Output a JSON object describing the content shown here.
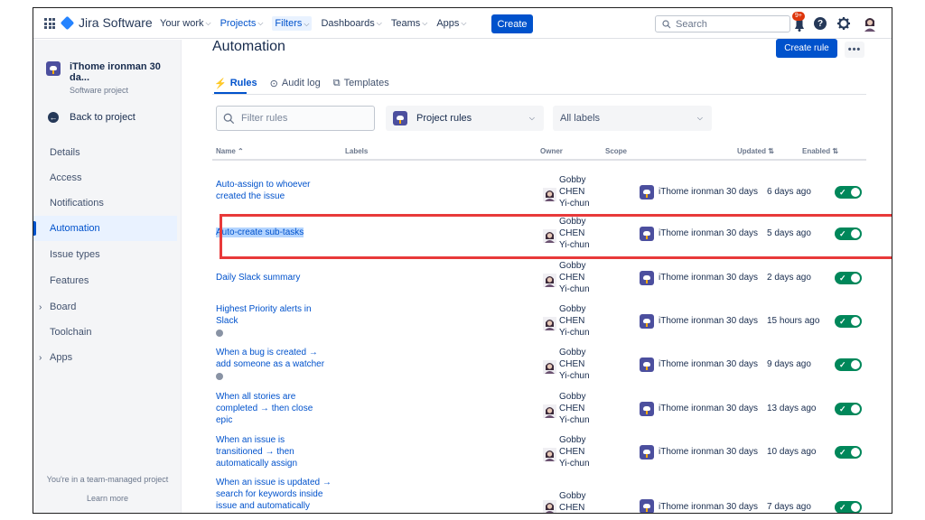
{
  "topnav": {
    "logo": "Jira Software",
    "items": [
      {
        "label": "Your work"
      },
      {
        "label": "Projects"
      },
      {
        "label": "Filters"
      },
      {
        "label": "Dashboards"
      },
      {
        "label": "Teams"
      },
      {
        "label": "Apps"
      }
    ],
    "create": "Create",
    "search_placeholder": "Search",
    "notifications_badge": "9+",
    "help": "?"
  },
  "sidebar": {
    "project_name": "iThome ironman 30 da...",
    "project_type": "Software project",
    "back": "Back to project",
    "items": [
      {
        "label": "Details"
      },
      {
        "label": "Access"
      },
      {
        "label": "Notifications"
      },
      {
        "label": "Automation"
      },
      {
        "label": "Issue types"
      },
      {
        "label": "Features"
      },
      {
        "label": "Board"
      },
      {
        "label": "Toolchain"
      },
      {
        "label": "Apps"
      }
    ],
    "footer_text": "You're in a team-managed project",
    "footer_link": "Learn more"
  },
  "main": {
    "title": "Automation",
    "create_rule": "Create rule",
    "more": "•••",
    "tabs": [
      {
        "label": "Rules"
      },
      {
        "label": "Audit log"
      },
      {
        "label": "Templates"
      }
    ],
    "filter_placeholder": "Filter rules",
    "project_select": "Project rules",
    "labels_select": "All labels",
    "columns": {
      "name": "Name",
      "labels": "Labels",
      "owner": "Owner",
      "scope": "Scope",
      "updated": "Updated",
      "enabled": "Enabled"
    },
    "owner_lines": [
      "Gobby",
      "CHEN",
      "Yi-chun"
    ],
    "scope": "iThome ironman 30 days",
    "rules": [
      {
        "name": "Auto-assign to whoever created the issue",
        "updated": "6 days ago"
      },
      {
        "name": "Auto-create sub-tasks",
        "updated": "5 days ago"
      },
      {
        "name": "Daily Slack summary",
        "updated": "2 days ago"
      },
      {
        "name": "Highest Priority alerts in Slack",
        "updated": "15 hours ago"
      },
      {
        "name": "When a bug is created → add someone as a watcher",
        "updated": "9 days ago"
      },
      {
        "name": "When all stories are completed → then close epic",
        "updated": "13 days ago"
      },
      {
        "name": "When an issue is transitioned → then automatically assign",
        "updated": "10 days ago"
      },
      {
        "name": "When an issue is updated → search for keywords inside issue and automatically",
        "updated": "7 days ago"
      }
    ]
  },
  "colors": {
    "brand": "#0052cc",
    "toggle_on": "#00875a",
    "highlight": "#e8393a"
  }
}
